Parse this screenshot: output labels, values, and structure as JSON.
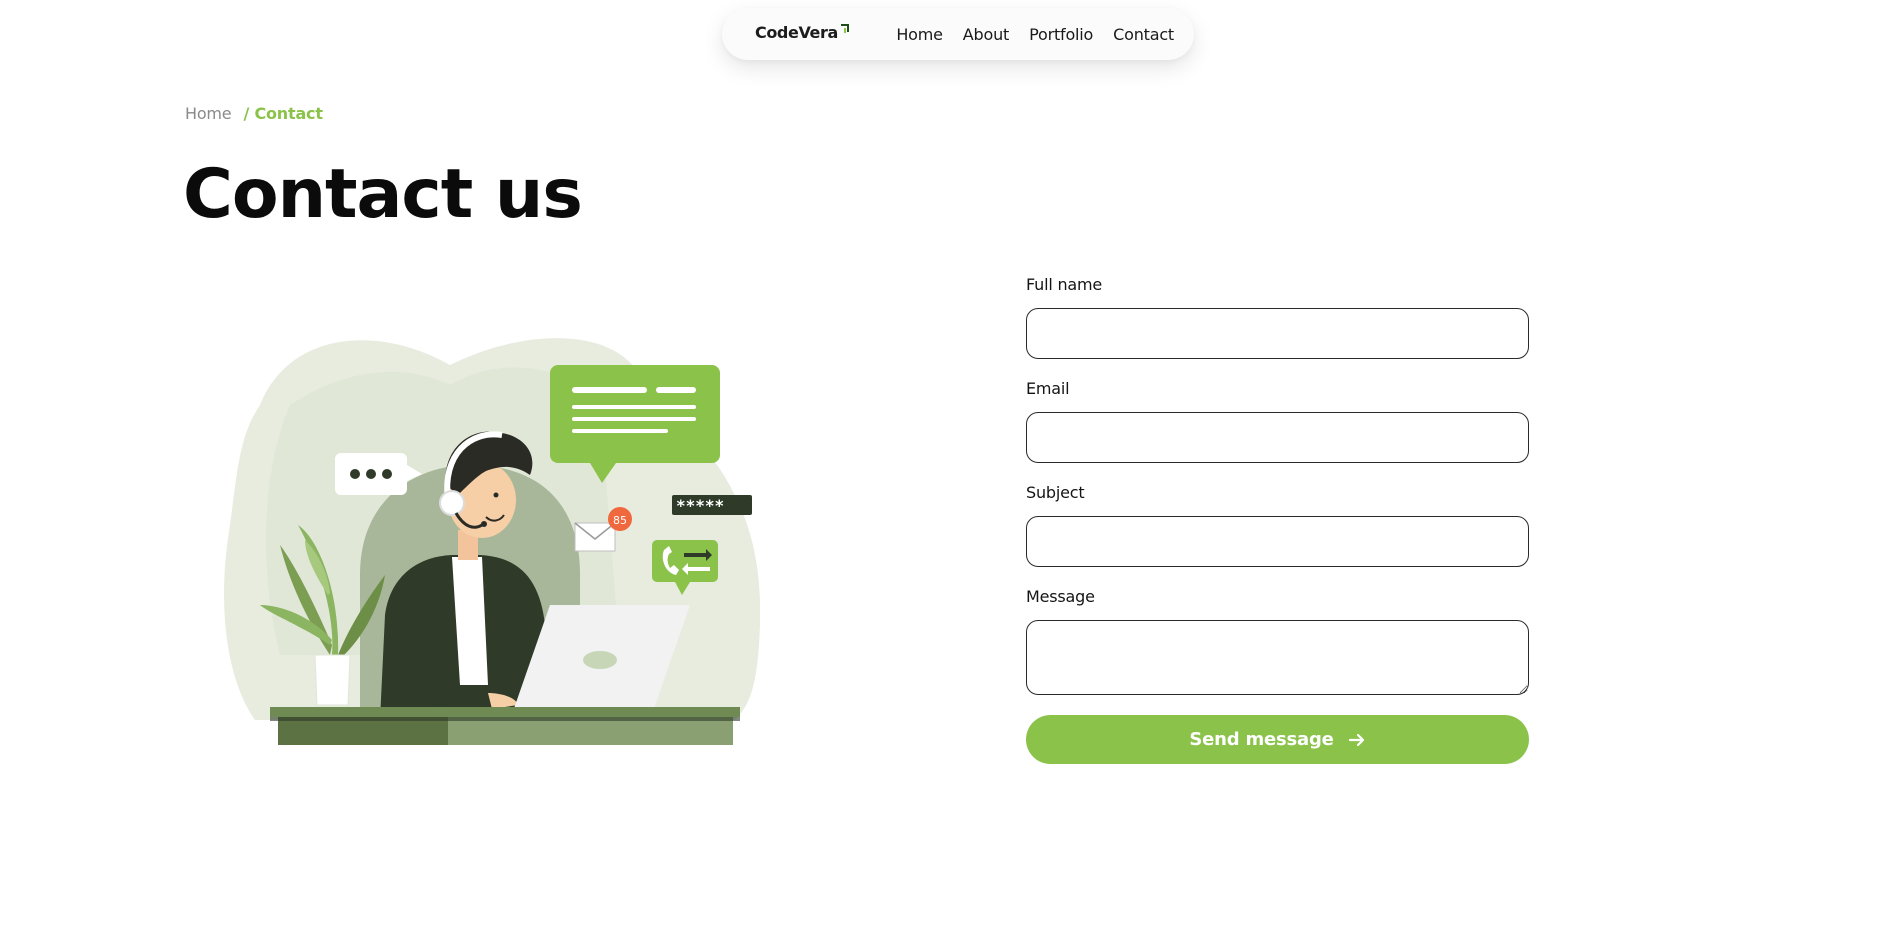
{
  "nav": {
    "logo_text": "CodeVera",
    "links": [
      {
        "label": "Home"
      },
      {
        "label": "About"
      },
      {
        "label": "Portfolio"
      },
      {
        "label": "Contact"
      }
    ]
  },
  "breadcrumb": {
    "home": "Home",
    "current": "/ Contact"
  },
  "page": {
    "title": "Contact us"
  },
  "illustration": {
    "alt_icon": "customer-support-illustration",
    "password_mask": "*****",
    "mail_badge": "85"
  },
  "form": {
    "fields": [
      {
        "label": "Full name",
        "value": "",
        "placeholder": ""
      },
      {
        "label": "Email",
        "value": "",
        "placeholder": ""
      },
      {
        "label": "Subject",
        "value": "",
        "placeholder": ""
      },
      {
        "label": "Message",
        "value": "",
        "placeholder": ""
      }
    ],
    "submit_label": "Send message",
    "submit_icon": "arrow-right-icon"
  },
  "colors": {
    "accent": "#8bc34a",
    "text": "#111111",
    "muted": "#8a8a8a"
  }
}
